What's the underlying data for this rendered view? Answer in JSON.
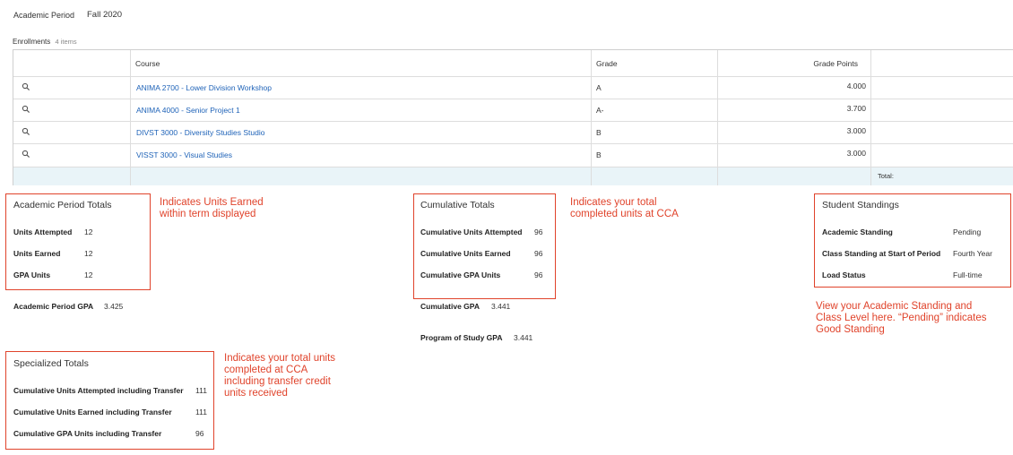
{
  "header": {
    "period_label": "Academic Period",
    "period_value": "Fall 2020"
  },
  "enrollments": {
    "title": "Enrollments",
    "count": "4 items",
    "columns": [
      "Course",
      "Grade",
      "Grade Points"
    ],
    "rows": [
      {
        "course": "ANIMA 2700 - Lower Division Workshop",
        "grade": "A",
        "points": "4.000"
      },
      {
        "course": "ANIMA 4000 - Senior Project 1",
        "grade": "A-",
        "points": "3.700"
      },
      {
        "course": "DIVST 3000 - Diversity Studies Studio",
        "grade": "B",
        "points": "3.000"
      },
      {
        "course": "VISST 3000 - Visual Studies",
        "grade": "B",
        "points": "3.000"
      }
    ],
    "total_label": "Total:"
  },
  "period_totals": {
    "title": "Academic Period Totals",
    "rows": [
      {
        "label": "Units Attempted",
        "value": "12"
      },
      {
        "label": "Units Earned",
        "value": "12"
      },
      {
        "label": "GPA Units",
        "value": "12"
      }
    ],
    "gpa_label": "Academic Period GPA",
    "gpa_value": "3.425"
  },
  "cumulative_totals": {
    "title": "Cumulative Totals",
    "rows": [
      {
        "label": "Cumulative Units Attempted",
        "value": "96"
      },
      {
        "label": "Cumulative Units Earned",
        "value": "96"
      },
      {
        "label": "Cumulative GPA Units",
        "value": "96"
      }
    ],
    "gpa_label": "Cumulative GPA",
    "gpa_value": "3.441",
    "program_gpa_label": "Program of Study GPA",
    "program_gpa_value": "3.441"
  },
  "student_standings": {
    "title": "Student Standings",
    "rows": [
      {
        "label": "Academic Standing",
        "value": "Pending"
      },
      {
        "label": "Class Standing at Start of Period",
        "value": "Fourth Year"
      },
      {
        "label": "Load Status",
        "value": "Full-time"
      }
    ]
  },
  "specialized_totals": {
    "title": "Specialized Totals",
    "rows": [
      {
        "label": "Cumulative Units Attempted including Transfer",
        "value": "111"
      },
      {
        "label": "Cumulative Units Earned including Transfer",
        "value": "111"
      },
      {
        "label": "Cumulative GPA Units including Transfer",
        "value": "96"
      }
    ]
  },
  "annotations": {
    "period_note": "Indicates Units Earned within term displayed",
    "cumulative_note": "Indicates your total completed units at CCA",
    "standing_note": "View your Academic Standing and Class Level here. “Pending” indicates Good Standing",
    "specialized_note": "Indicates your total units completed at CCA including transfer credit units received"
  },
  "colors": {
    "annotation": "#e0432b",
    "link": "#1f63b8",
    "total_row": "#e9f4f8"
  },
  "icons": {
    "row_action": "search-icon"
  }
}
